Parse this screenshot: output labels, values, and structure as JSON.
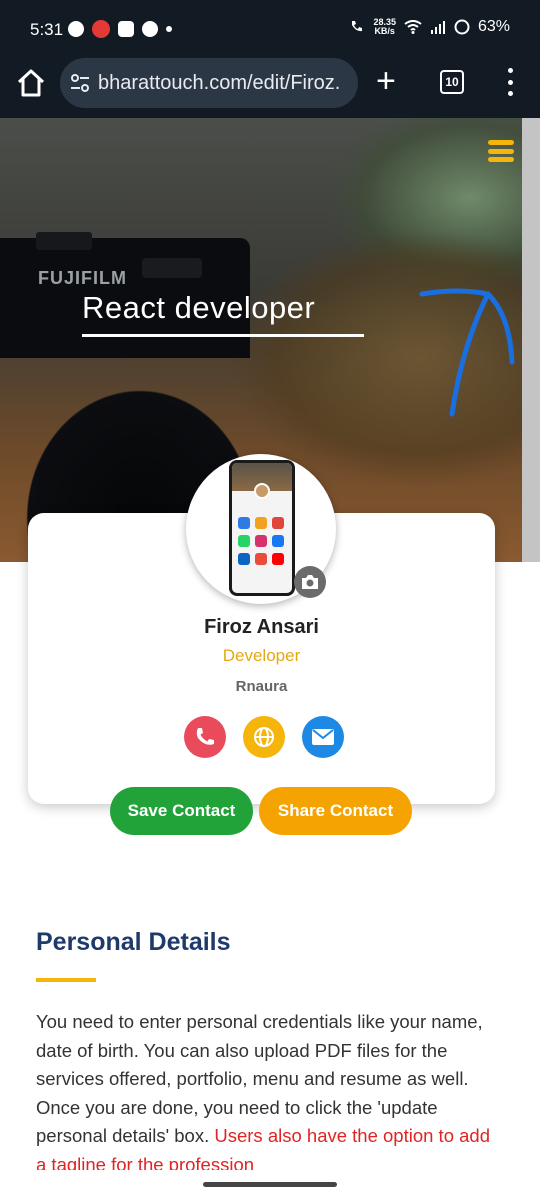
{
  "status_bar": {
    "time": "5:31",
    "net_speed": "28.35",
    "net_unit": "KB/s",
    "battery": "63%"
  },
  "browser": {
    "url": "bharattouch.com/edit/Firoz.",
    "tab_count": "10"
  },
  "hero": {
    "brand_text": "FUJIFILM",
    "tagline": "React developer"
  },
  "profile": {
    "name": "Firoz Ansari",
    "role": "Developer",
    "company": "Rnaura"
  },
  "buttons": {
    "save": "Save Contact",
    "share": "Share Contact"
  },
  "personal": {
    "title": "Personal Details",
    "body": "You need to enter personal credentials like your name, date of birth. You can also upload PDF files for the services offered, portfolio, menu and resume as well. Once you are done, you need to click the 'update personal details' box.",
    "body_highlight": "Users also have the option to add a tagline for the profession"
  },
  "colors": {
    "accent_yellow": "#f5b50a",
    "call": "#e94b5b",
    "web": "#f5b50a",
    "mail": "#1e88e5",
    "save_green": "#22a33a",
    "share_orange": "#f5a300",
    "title_navy": "#1e3a6a",
    "annotation_blue": "#1a6fe0"
  },
  "icons": [
    "home-icon",
    "tune-icon",
    "plus-icon",
    "tabs-icon",
    "more-vert-icon",
    "hamburger-icon",
    "camera-icon",
    "phone-icon",
    "globe-icon",
    "mail-icon"
  ]
}
